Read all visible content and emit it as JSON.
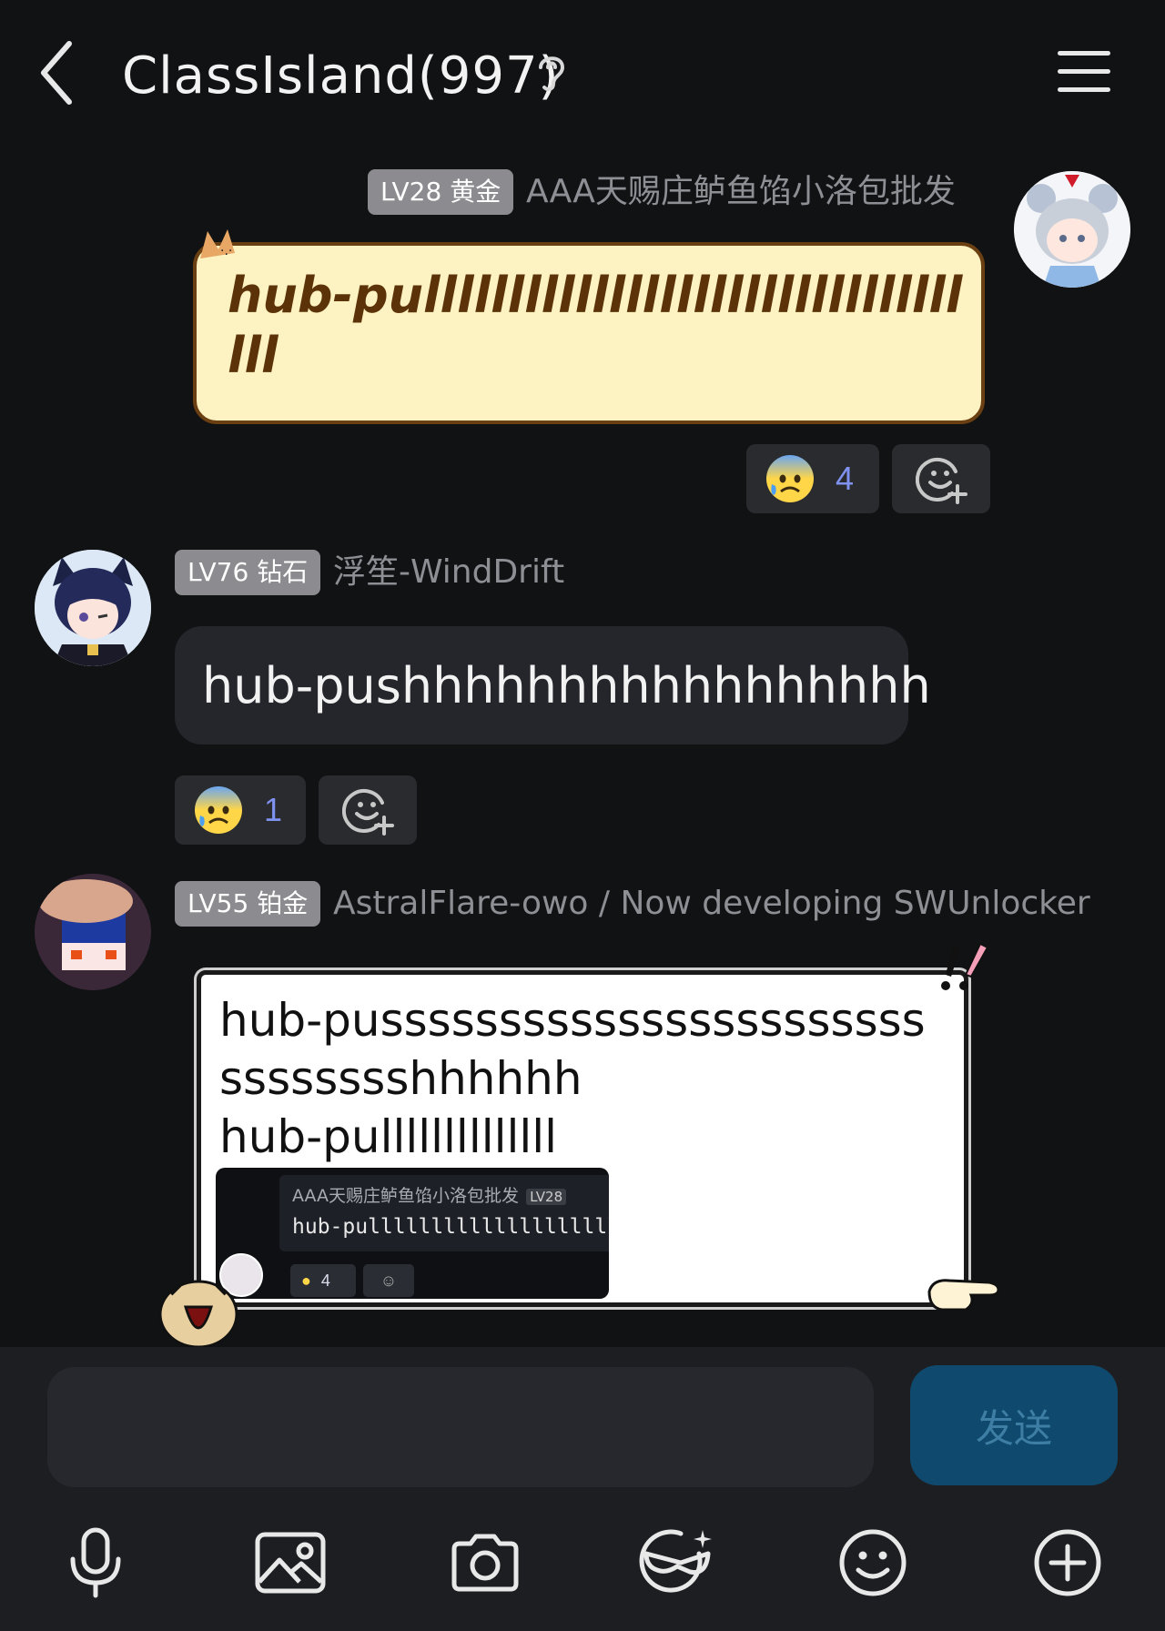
{
  "header": {
    "title": "ClassIsland(997)"
  },
  "messages": [
    {
      "badge": "LV28 黄金",
      "sender": "AAA天赐庄鲈鱼馅小洛包批发",
      "text": "hub-pulllllllllllllllllllllllllllllllllll",
      "reaction_count": "4"
    },
    {
      "badge": "LV76 钻石",
      "sender": "浮笙-WindDrift",
      "text": "hub-pushhhhhhhhhhhhhhhhh",
      "reaction_count": "1"
    },
    {
      "badge": "LV55 铂金",
      "sender": "AstralFlare-owo / Now developing SWUnlocker",
      "text_line1": "hub-pussssssssssssssssssssssssssssssshhhhhh",
      "text_line2": "hub-pullllllllllllll",
      "quoted": {
        "sender": "AAA天赐庄鲈鱼馅小洛包批发",
        "badge": "LV28",
        "text": "hub-pullllllllllllllllllll",
        "reaction_count": "4"
      }
    }
  ],
  "input": {
    "value": "",
    "send_label": "发送"
  },
  "toolbar_icons": [
    "microphone-icon",
    "image-icon",
    "camera-icon",
    "sticker-icon",
    "emoji-icon",
    "plus-icon"
  ]
}
